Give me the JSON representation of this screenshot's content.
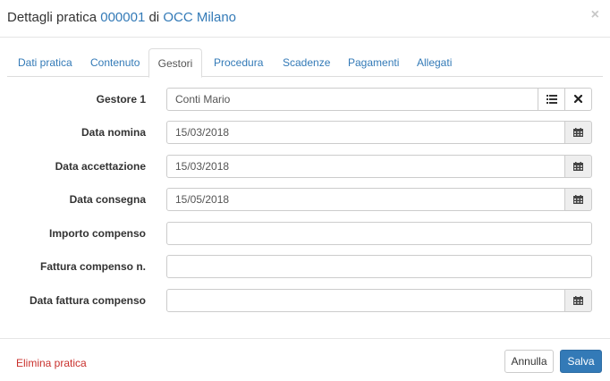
{
  "header": {
    "title_prefix": "Dettagli pratica",
    "pratica_number": "000001",
    "title_mid": "di",
    "occ_name": "OCC Milano",
    "close_symbol": "×"
  },
  "tabs": [
    {
      "label": "Dati pratica",
      "active": false
    },
    {
      "label": "Contenuto",
      "active": false
    },
    {
      "label": "Gestori",
      "active": true
    },
    {
      "label": "Procedura",
      "active": false
    },
    {
      "label": "Scadenze",
      "active": false
    },
    {
      "label": "Pagamenti",
      "active": false
    },
    {
      "label": "Allegati",
      "active": false
    }
  ],
  "form": {
    "gestore": {
      "label": "Gestore 1",
      "value": "Conti Mario"
    },
    "data_nomina": {
      "label": "Data nomina",
      "value": "15/03/2018"
    },
    "data_accettazione": {
      "label": "Data accettazione",
      "value": "15/03/2018"
    },
    "data_consegna": {
      "label": "Data consegna",
      "value": "15/05/2018"
    },
    "importo_compenso": {
      "label": "Importo compenso",
      "value": ""
    },
    "fattura_compenso": {
      "label": "Fattura compenso n.",
      "value": ""
    },
    "data_fattura_compenso": {
      "label": "Data fattura compenso",
      "value": ""
    }
  },
  "footer": {
    "delete_label": "Elimina pratica",
    "cancel_label": "Annulla",
    "save_label": "Salva"
  },
  "colors": {
    "link": "#337ab7",
    "danger": "#c9302c",
    "primary": "#337ab7"
  },
  "icons": {
    "close": "close-icon",
    "list": "list-icon",
    "remove": "times-icon",
    "calendar": "calendar-icon"
  }
}
